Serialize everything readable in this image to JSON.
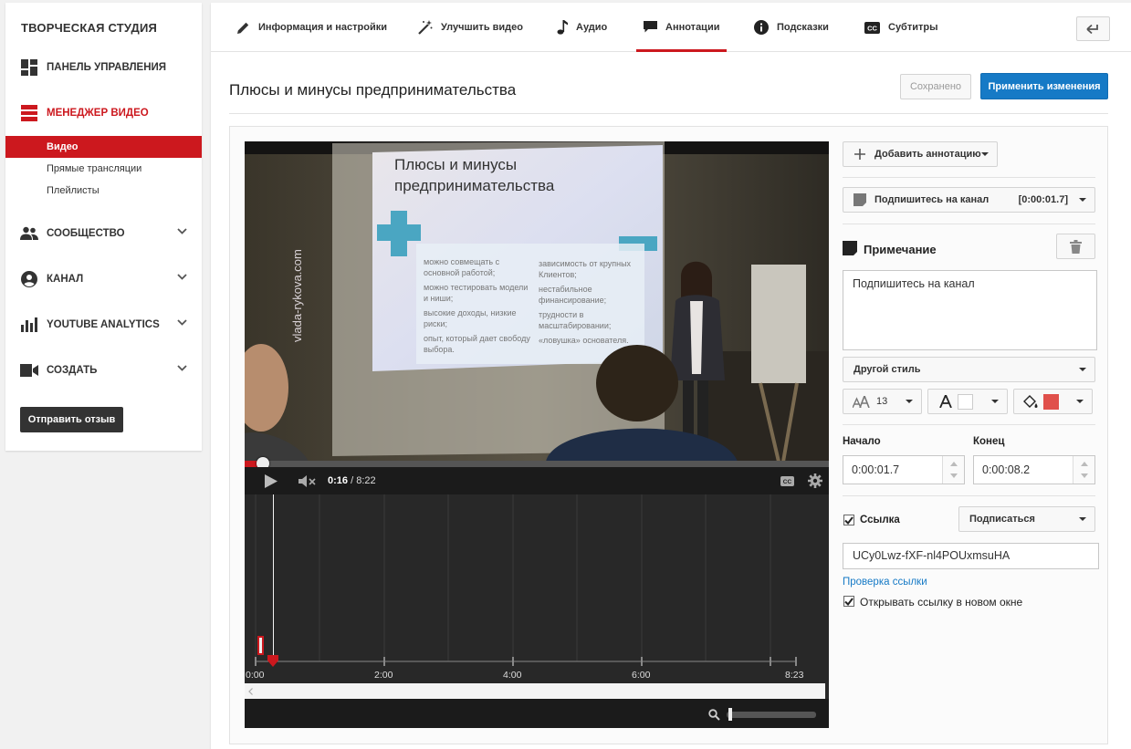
{
  "sidebar": {
    "brand": "ТВОРЧЕСКАЯ СТУДИЯ",
    "items": [
      {
        "label": "ПАНЕЛЬ УПРАВЛЕНИЯ",
        "icon": "dashboard-icon"
      },
      {
        "label": "МЕНЕДЖЕР ВИДЕО",
        "icon": "video-manager-icon"
      },
      {
        "label": "СООБЩЕСТВО",
        "icon": "community-icon"
      },
      {
        "label": "КАНАЛ",
        "icon": "channel-icon"
      },
      {
        "label": "YOUTUBE ANALYTICS",
        "icon": "analytics-icon"
      },
      {
        "label": "СОЗДАТЬ",
        "icon": "create-icon"
      }
    ],
    "sub_items": [
      "Видео",
      "Прямые трансляции",
      "Плейлисты"
    ],
    "feedback_button": "Отправить отзыв",
    "accent": "#cc181e"
  },
  "tabs": [
    {
      "label": "Информация и настройки",
      "icon": "pencil-icon"
    },
    {
      "label": "Улучшить видео",
      "icon": "magic-wand-icon"
    },
    {
      "label": "Аудио",
      "icon": "music-note-icon"
    },
    {
      "label": "Аннотации",
      "icon": "speech-bubble-icon",
      "active": true
    },
    {
      "label": "Подсказки",
      "icon": "info-icon"
    },
    {
      "label": "Субтитры",
      "icon": "cc-icon"
    }
  ],
  "page": {
    "title": "Плюсы и минусы предпринимательства",
    "saved_button": "Сохранено",
    "apply_button": "Применить изменения",
    "apply_color": "#167ac6"
  },
  "slide": {
    "heading_line1": "Плюсы и минусы",
    "heading_line2": "предпринимательства",
    "pros": [
      "можно совмещать с основной работой;",
      "можно тестировать модели и ниши;",
      "высокие доходы, низкие риски;",
      "опыт, который дает свободу выбора."
    ],
    "cons": [
      "зависимость от крупных Клиентов;",
      "нестабильное финансирование;",
      "трудности в масштабировании;",
      "«ловушка» основателя."
    ],
    "watermark": "vlada-rykova.com"
  },
  "player": {
    "current_time": "0:16",
    "duration": "/ 8:22",
    "progress": 0.032
  },
  "timeline": {
    "ticks": [
      "0:00",
      "2:00",
      "4:00",
      "6:00",
      "8:23"
    ],
    "zoom_level": 0.02
  },
  "panel": {
    "add_annotation": "Добавить аннотацию",
    "annotation_item_label": "Подпишитесь на канал",
    "annotation_item_time": "[0:00:01.7]",
    "note_title": "Примечание",
    "note_text": "Подпишитесь на канал",
    "style_select": "Другой стиль",
    "font_size": "13",
    "text_color": "#ffffff",
    "bg_color": "#e0504b",
    "start_label": "Начало",
    "end_label": "Конец",
    "start_value": "0:00:01.7",
    "end_value": "0:00:08.2",
    "link_label": "Ссылка",
    "link_checked": true,
    "link_type": "Подписаться",
    "link_value": "UCy0Lwz-fXF-nl4POUxmsuHA",
    "check_link": "Проверка ссылки",
    "open_new_window": "Открывать ссылку в новом окне",
    "open_new_checked": true
  }
}
